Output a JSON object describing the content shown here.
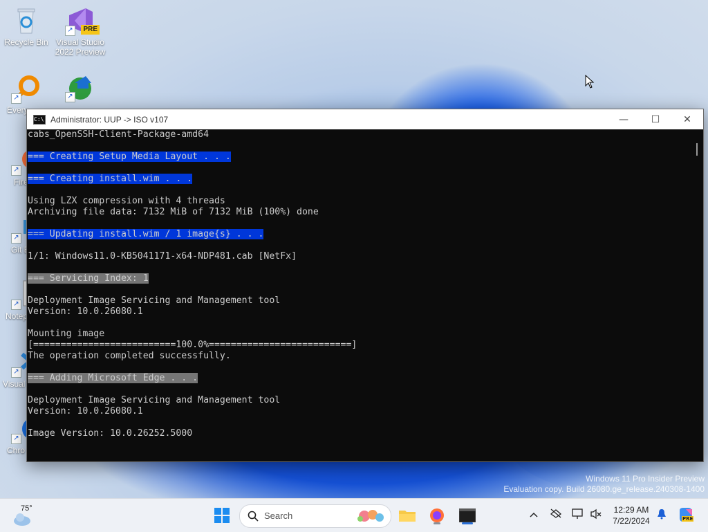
{
  "desktop": {
    "icons": [
      {
        "label": "Recycle Bin"
      },
      {
        "label": "Visual Studio 2022 Preview",
        "badge": "PRE"
      },
      {
        "label": "Every"
      },
      {
        "label": ""
      },
      {
        "label": "Fire"
      },
      {
        "label": "Git B"
      },
      {
        "label": "Notep"
      },
      {
        "label": "Visual Co"
      },
      {
        "label": "Chro"
      }
    ]
  },
  "window": {
    "title": "Administrator:  UUP -> ISO v107",
    "controls": {
      "minimize": "—",
      "maximize": "☐",
      "close": "✕"
    },
    "console_lines": [
      {
        "text": "cabs_OpenSSH-Client-Package-amd64",
        "style": ""
      },
      {
        "text": "",
        "style": ""
      },
      {
        "text": "=== Creating Setup Media Layout . . .",
        "style": "hl-blue"
      },
      {
        "text": "",
        "style": ""
      },
      {
        "text": "=== Creating install.wim . . .",
        "style": "hl-blue"
      },
      {
        "text": "",
        "style": ""
      },
      {
        "text": "Using LZX compression with 4 threads",
        "style": ""
      },
      {
        "text": "Archiving file data: 7132 MiB of 7132 MiB (100%) done",
        "style": ""
      },
      {
        "text": "",
        "style": ""
      },
      {
        "text": "=== Updating install.wim / 1 image{s} . . .",
        "style": "hl-blue"
      },
      {
        "text": "",
        "style": ""
      },
      {
        "text": "1/1: Windows11.0-KB5041171-x64-NDP481.cab [NetFx]",
        "style": ""
      },
      {
        "text": "",
        "style": ""
      },
      {
        "text": "=== Servicing Index: 1",
        "style": "hl-gray"
      },
      {
        "text": "",
        "style": ""
      },
      {
        "text": "Deployment Image Servicing and Management tool",
        "style": ""
      },
      {
        "text": "Version: 10.0.26080.1",
        "style": ""
      },
      {
        "text": "",
        "style": ""
      },
      {
        "text": "Mounting image",
        "style": ""
      },
      {
        "text": "[==========================100.0%==========================]",
        "style": ""
      },
      {
        "text": "The operation completed successfully.",
        "style": ""
      },
      {
        "text": "",
        "style": ""
      },
      {
        "text": "=== Adding Microsoft Edge . . .",
        "style": "hl-gray"
      },
      {
        "text": "",
        "style": ""
      },
      {
        "text": "Deployment Image Servicing and Management tool",
        "style": ""
      },
      {
        "text": "Version: 10.0.26080.1",
        "style": ""
      },
      {
        "text": "",
        "style": ""
      },
      {
        "text": "Image Version: 10.0.26252.5000",
        "style": ""
      },
      {
        "text": "",
        "style": ""
      }
    ]
  },
  "watermark": {
    "line1": "Windows 11 Pro Insider Preview",
    "line2": "Evaluation copy. Build 26080.ge_release.240308-1400"
  },
  "taskbar": {
    "weather_temp": "75°",
    "search_placeholder": "Search",
    "clock_time": "12:29 AM",
    "clock_date": "7/22/2024",
    "copilot_badge": "PRE"
  },
  "colors": {
    "console_bg": "#0c0c0c",
    "console_fg": "#cccccc",
    "highlight_blue": "#0037da",
    "highlight_gray": "#767676"
  }
}
